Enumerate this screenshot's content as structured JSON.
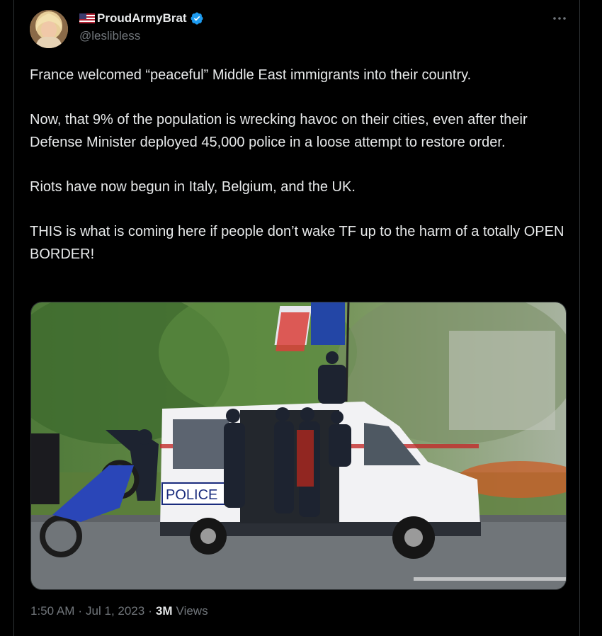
{
  "author": {
    "flag_icon": "us-flag-icon",
    "display_name": "ProudArmyBrat",
    "verified_icon": "verified-badge-icon",
    "handle": "@leslibless"
  },
  "menu_icon": "more-options-icon",
  "tweet": {
    "paragraphs": [
      "France welcomed “peaceful” Middle East immigrants into their country.",
      "Now, that 9% of the population is wrecking havoc on their cities, even after their Defense Minister deployed 45,000 police in a loose attempt to restore order.",
      "Riots have now begun in Italy, Belgium, and the UK.",
      "THIS is what is coming here if people don’t wake TF up to the harm of a totally OPEN BORDER!"
    ]
  },
  "media": {
    "van_label": "POLICE"
  },
  "meta": {
    "time": "1:50 AM",
    "separator": "·",
    "date": "Jul 1, 2023",
    "views_count": "3M",
    "views_label": "Views"
  },
  "colors": {
    "background": "#000000",
    "text": "#e7e9ea",
    "muted": "#71767b",
    "verified": "#1d9bf0",
    "border": "#2f3336"
  }
}
